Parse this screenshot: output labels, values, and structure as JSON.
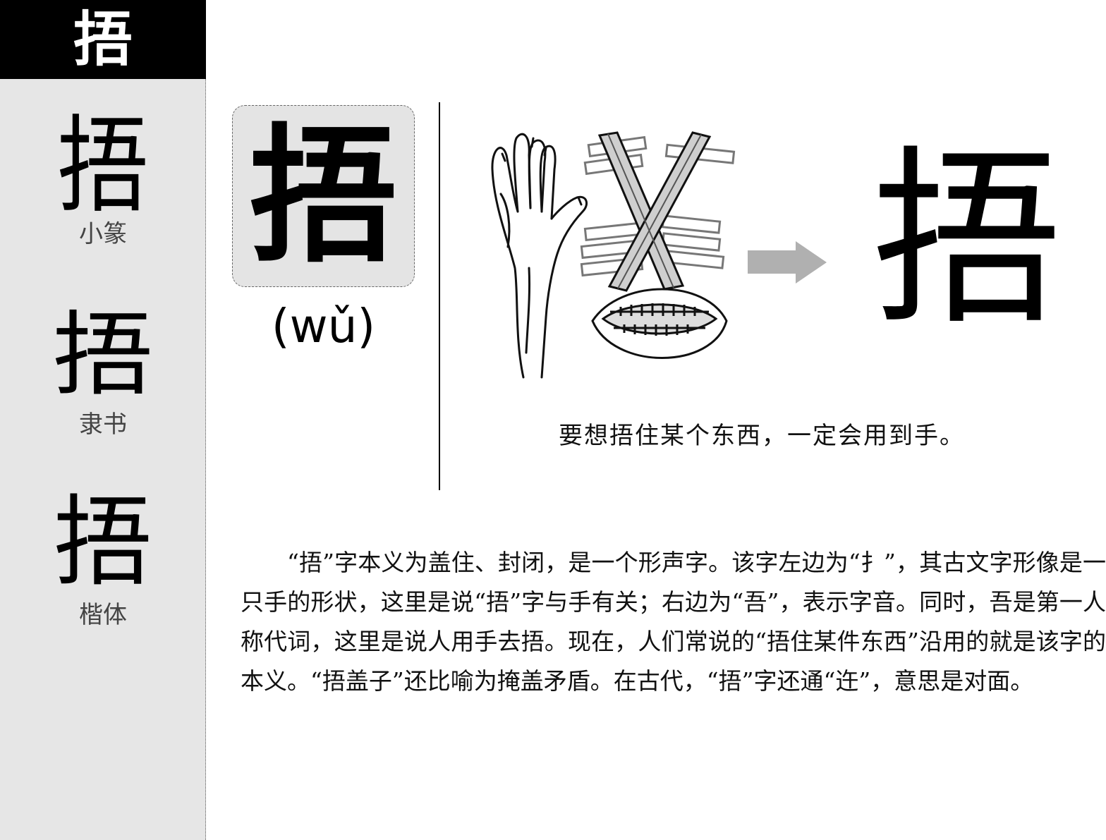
{
  "header": {
    "character": "捂"
  },
  "sidebar": {
    "scripts": [
      {
        "glyph": "捂",
        "label": "小篆"
      },
      {
        "glyph": "捂",
        "label": "隶书"
      },
      {
        "glyph": "捂",
        "label": "楷体"
      }
    ]
  },
  "main_character": {
    "glyph": "捂",
    "pinyin": "(wǔ)"
  },
  "illustration": {
    "evolved_glyph": "捂"
  },
  "caption": "要想捂住某个东西，一定会用到手。",
  "description": "“捂”字本义为盖住、封闭，是一个形声字。该字左边为“扌”，其古文字形像是一只手的形状，这里是说“捂”字与手有关；右边为“吾”，表示字音。同时，吾是第一人称代词，这里是说人用手去捂。现在，人们常说的“捂住某件东西”沿用的就是该字的本义。“捂盖子”还比喻为掩盖矛盾。在古代，“捂”字还通“迕”，意思是对面。"
}
